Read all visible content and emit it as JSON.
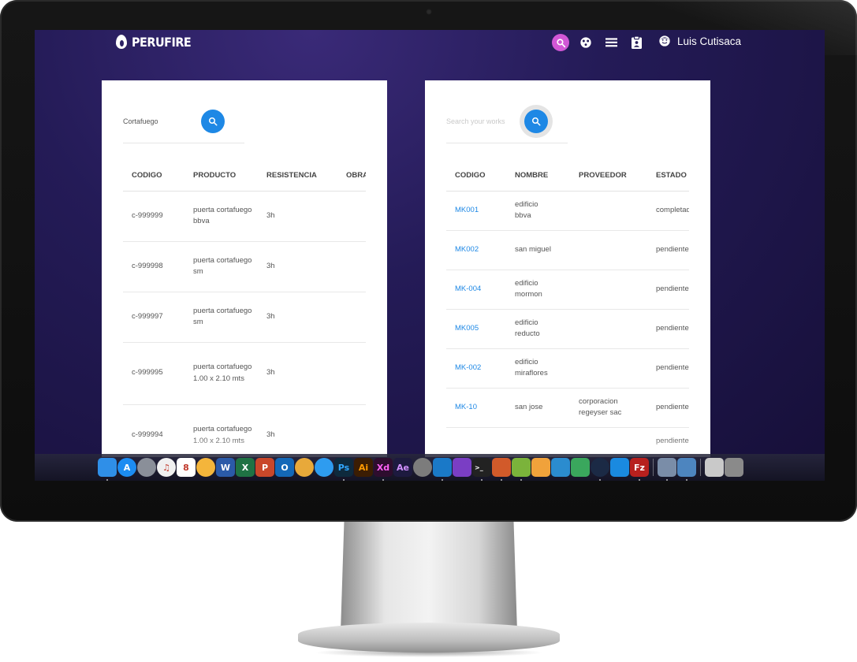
{
  "brand": {
    "name": "PERUFIRE"
  },
  "topbar": {
    "icons": [
      "search-icon",
      "dashboard-icon",
      "menu-icon",
      "clipboard-icon"
    ],
    "user_name": "Luis Cutisaca"
  },
  "left_panel": {
    "search_value": "Cortafuego",
    "columns": [
      "CODIGO",
      "PRODUCTO",
      "RESISTENCIA",
      "OBRA"
    ],
    "rows": [
      {
        "codigo": "c-999999",
        "producto": "puerta cortafuego bbva",
        "resistencia": "3h",
        "obra": ""
      },
      {
        "codigo": "c-999998",
        "producto": "puerta cortafuego sm",
        "resistencia": "3h",
        "obra": ""
      },
      {
        "codigo": "c-999997",
        "producto": "puerta cortafuego sm",
        "resistencia": "3h",
        "obra": ""
      },
      {
        "codigo": "c-999995",
        "producto": "puerta cortafuego 1.00 x 2.10 mts",
        "resistencia": "3h",
        "obra": ""
      },
      {
        "codigo": "c-999994",
        "producto": "puerta cortafuego 1.00 x 2.10 mts",
        "resistencia": "3h",
        "obra": ""
      }
    ]
  },
  "right_panel": {
    "search_placeholder": "Search your works",
    "columns": [
      "CODIGO",
      "NOMBRE",
      "PROVEEDOR",
      "ESTADO"
    ],
    "rows": [
      {
        "codigo": "MK001",
        "nombre": "edificio bbva",
        "proveedor": "",
        "estado": "completado"
      },
      {
        "codigo": "MK002",
        "nombre": "san miguel",
        "proveedor": "",
        "estado": "pendiente"
      },
      {
        "codigo": "MK-004",
        "nombre": "edificio mormon",
        "proveedor": "",
        "estado": "pendiente"
      },
      {
        "codigo": "MK005",
        "nombre": "edificio reducto",
        "proveedor": "",
        "estado": "pendiente"
      },
      {
        "codigo": "MK-002",
        "nombre": "edificio miraflores",
        "proveedor": "",
        "estado": "pendiente"
      },
      {
        "codigo": "MK-10",
        "nombre": "san jose",
        "proveedor": "corporacion regeyser sac",
        "estado": "pendiente"
      },
      {
        "codigo": "",
        "nombre": "",
        "proveedor": "",
        "estado": "pendiente"
      }
    ]
  },
  "dock": {
    "apps": [
      {
        "name": "finder-icon",
        "glyph": "",
        "color": "#2f8fe8"
      },
      {
        "name": "app-store-icon",
        "glyph": "A",
        "color": "#1c8cf2"
      },
      {
        "name": "launchpad-icon",
        "glyph": "",
        "color": "#8a8f99"
      },
      {
        "name": "itunes-icon",
        "glyph": "♫",
        "color": "#f0f0f0"
      },
      {
        "name": "calendar-icon",
        "glyph": "8",
        "color": "#ffffff"
      },
      {
        "name": "photos-icon",
        "glyph": "",
        "color": "#f4b53b"
      },
      {
        "name": "word-icon",
        "glyph": "W",
        "color": "#2b5aa8"
      },
      {
        "name": "excel-icon",
        "glyph": "X",
        "color": "#1f7244"
      },
      {
        "name": "powerpoint-icon",
        "glyph": "P",
        "color": "#c9472a"
      },
      {
        "name": "outlook-icon",
        "glyph": "O",
        "color": "#1468b8"
      },
      {
        "name": "chrome-icon",
        "glyph": "",
        "color": "#e8a93a"
      },
      {
        "name": "safari-icon",
        "glyph": "",
        "color": "#2e9cf0"
      },
      {
        "name": "photoshop-icon",
        "glyph": "Ps",
        "color": "#0e2a3d"
      },
      {
        "name": "illustrator-icon",
        "glyph": "Ai",
        "color": "#3b1d03"
      },
      {
        "name": "xd-icon",
        "glyph": "Xd",
        "color": "#2e0d2e"
      },
      {
        "name": "after-effects-icon",
        "glyph": "Ae",
        "color": "#1d1a3f"
      },
      {
        "name": "system-preferences-icon",
        "glyph": "",
        "color": "#7c7c7c"
      },
      {
        "name": "vscode-icon",
        "glyph": "",
        "color": "#1a79c8"
      },
      {
        "name": "visual-studio-icon",
        "glyph": "",
        "color": "#7a3ec4"
      },
      {
        "name": "terminal-icon",
        "glyph": ">_",
        "color": "#222222"
      },
      {
        "name": "archive-icon",
        "glyph": "",
        "color": "#d25a2a"
      },
      {
        "name": "chameleon-icon",
        "glyph": "",
        "color": "#7bb33b"
      },
      {
        "name": "sequel-icon",
        "glyph": "",
        "color": "#f0a23b"
      },
      {
        "name": "elephant-icon",
        "glyph": "",
        "color": "#2b8ccf"
      },
      {
        "name": "rocket-icon",
        "glyph": "",
        "color": "#3aa75d"
      },
      {
        "name": "steam-icon",
        "glyph": "",
        "color": "#1b2a45"
      },
      {
        "name": "vscode-blue-icon",
        "glyph": "",
        "color": "#1a8ae0"
      },
      {
        "name": "filezilla-icon",
        "glyph": "Fz",
        "color": "#b7201e"
      },
      {
        "name": "preview-icon",
        "glyph": "",
        "color": "#7a8da8"
      },
      {
        "name": "photo-viewer-icon",
        "glyph": "",
        "color": "#4d85bf"
      },
      {
        "name": "documents-icon",
        "glyph": "",
        "color": "#c9c9c9"
      },
      {
        "name": "trash-icon",
        "glyph": "",
        "color": "#8a8a8a"
      }
    ]
  }
}
